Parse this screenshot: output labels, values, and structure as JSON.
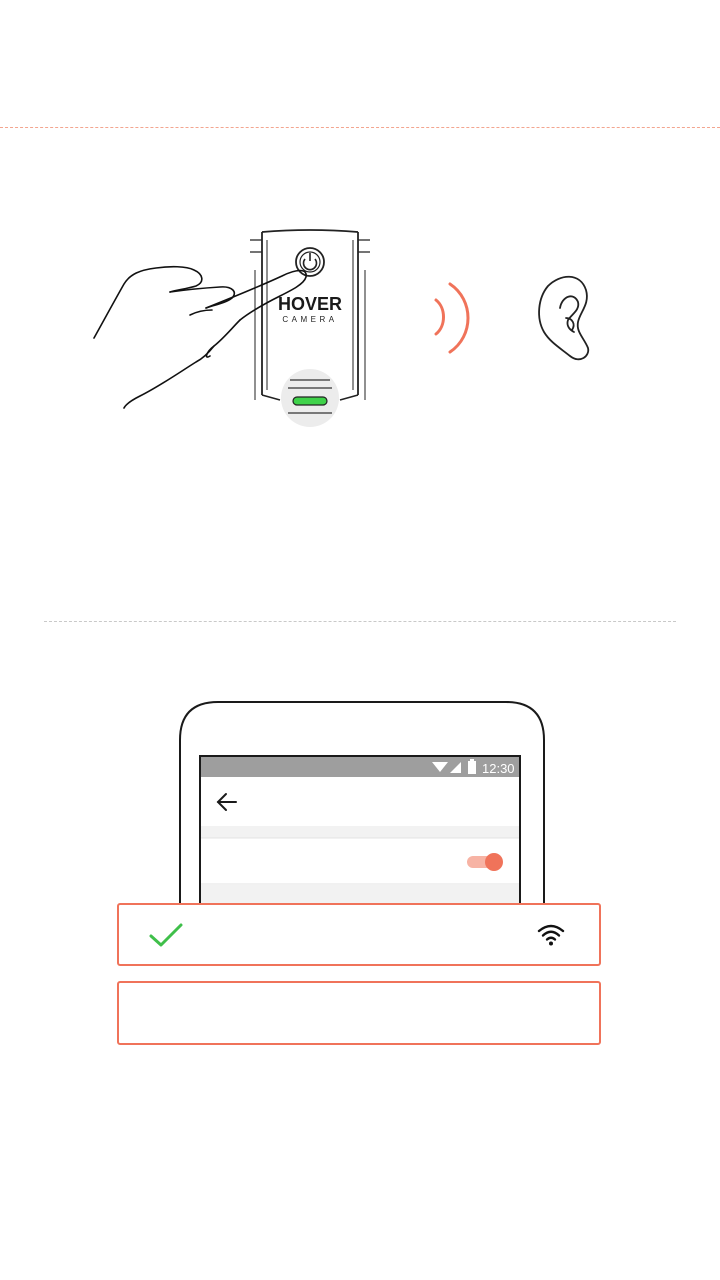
{
  "illustration": {
    "brand_name": "HOVER",
    "brand_sub": "CAMERA",
    "icons": {
      "hand": "hand-pointer-icon",
      "power": "power-icon",
      "sound": "sound-wave-icon",
      "ear": "ear-icon",
      "led": "status-led-icon"
    },
    "led_color": "#3fd24a"
  },
  "phone": {
    "status_time": "12:30",
    "icons": {
      "back": "back-arrow-icon",
      "wifi_status": "wifi-icon",
      "signal": "signal-icon",
      "battery": "battery-icon"
    },
    "toggle_state": "on",
    "accent": "#f0735a"
  },
  "network_rows": [
    {
      "icon_left": "check-icon",
      "icon_right": "wifi-icon",
      "selected": true
    },
    {
      "icon_left": "",
      "icon_right": "",
      "selected": false
    }
  ],
  "colors": {
    "accent": "#f0735a",
    "check": "#3fbf4a",
    "status_bar": "#9e9e9e"
  }
}
